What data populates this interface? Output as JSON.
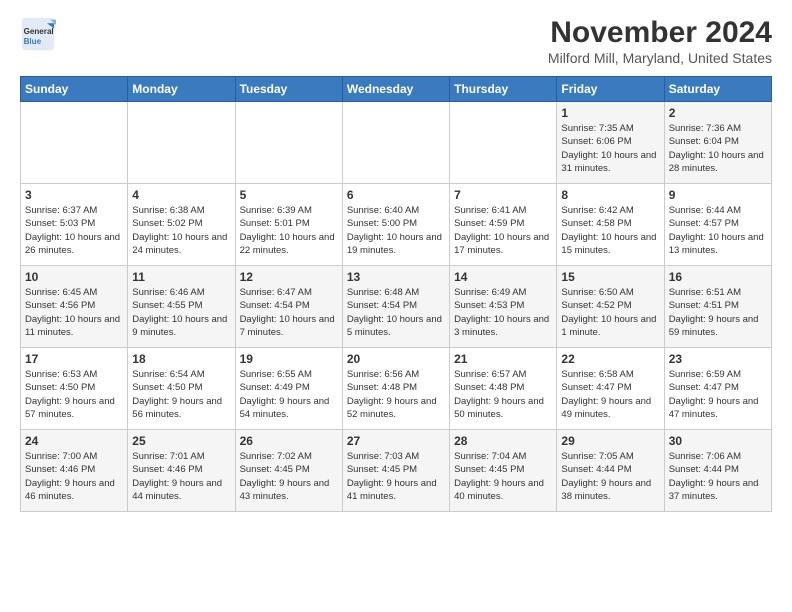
{
  "logo": {
    "general": "General",
    "blue": "Blue"
  },
  "header": {
    "title": "November 2024",
    "location": "Milford Mill, Maryland, United States"
  },
  "weekdays": [
    "Sunday",
    "Monday",
    "Tuesday",
    "Wednesday",
    "Thursday",
    "Friday",
    "Saturday"
  ],
  "weeks": [
    [
      {
        "day": "",
        "content": ""
      },
      {
        "day": "",
        "content": ""
      },
      {
        "day": "",
        "content": ""
      },
      {
        "day": "",
        "content": ""
      },
      {
        "day": "",
        "content": ""
      },
      {
        "day": "1",
        "content": "Sunrise: 7:35 AM\nSunset: 6:06 PM\nDaylight: 10 hours and 31 minutes."
      },
      {
        "day": "2",
        "content": "Sunrise: 7:36 AM\nSunset: 6:04 PM\nDaylight: 10 hours and 28 minutes."
      }
    ],
    [
      {
        "day": "3",
        "content": "Sunrise: 6:37 AM\nSunset: 5:03 PM\nDaylight: 10 hours and 26 minutes."
      },
      {
        "day": "4",
        "content": "Sunrise: 6:38 AM\nSunset: 5:02 PM\nDaylight: 10 hours and 24 minutes."
      },
      {
        "day": "5",
        "content": "Sunrise: 6:39 AM\nSunset: 5:01 PM\nDaylight: 10 hours and 22 minutes."
      },
      {
        "day": "6",
        "content": "Sunrise: 6:40 AM\nSunset: 5:00 PM\nDaylight: 10 hours and 19 minutes."
      },
      {
        "day": "7",
        "content": "Sunrise: 6:41 AM\nSunset: 4:59 PM\nDaylight: 10 hours and 17 minutes."
      },
      {
        "day": "8",
        "content": "Sunrise: 6:42 AM\nSunset: 4:58 PM\nDaylight: 10 hours and 15 minutes."
      },
      {
        "day": "9",
        "content": "Sunrise: 6:44 AM\nSunset: 4:57 PM\nDaylight: 10 hours and 13 minutes."
      }
    ],
    [
      {
        "day": "10",
        "content": "Sunrise: 6:45 AM\nSunset: 4:56 PM\nDaylight: 10 hours and 11 minutes."
      },
      {
        "day": "11",
        "content": "Sunrise: 6:46 AM\nSunset: 4:55 PM\nDaylight: 10 hours and 9 minutes."
      },
      {
        "day": "12",
        "content": "Sunrise: 6:47 AM\nSunset: 4:54 PM\nDaylight: 10 hours and 7 minutes."
      },
      {
        "day": "13",
        "content": "Sunrise: 6:48 AM\nSunset: 4:54 PM\nDaylight: 10 hours and 5 minutes."
      },
      {
        "day": "14",
        "content": "Sunrise: 6:49 AM\nSunset: 4:53 PM\nDaylight: 10 hours and 3 minutes."
      },
      {
        "day": "15",
        "content": "Sunrise: 6:50 AM\nSunset: 4:52 PM\nDaylight: 10 hours and 1 minute."
      },
      {
        "day": "16",
        "content": "Sunrise: 6:51 AM\nSunset: 4:51 PM\nDaylight: 9 hours and 59 minutes."
      }
    ],
    [
      {
        "day": "17",
        "content": "Sunrise: 6:53 AM\nSunset: 4:50 PM\nDaylight: 9 hours and 57 minutes."
      },
      {
        "day": "18",
        "content": "Sunrise: 6:54 AM\nSunset: 4:50 PM\nDaylight: 9 hours and 56 minutes."
      },
      {
        "day": "19",
        "content": "Sunrise: 6:55 AM\nSunset: 4:49 PM\nDaylight: 9 hours and 54 minutes."
      },
      {
        "day": "20",
        "content": "Sunrise: 6:56 AM\nSunset: 4:48 PM\nDaylight: 9 hours and 52 minutes."
      },
      {
        "day": "21",
        "content": "Sunrise: 6:57 AM\nSunset: 4:48 PM\nDaylight: 9 hours and 50 minutes."
      },
      {
        "day": "22",
        "content": "Sunrise: 6:58 AM\nSunset: 4:47 PM\nDaylight: 9 hours and 49 minutes."
      },
      {
        "day": "23",
        "content": "Sunrise: 6:59 AM\nSunset: 4:47 PM\nDaylight: 9 hours and 47 minutes."
      }
    ],
    [
      {
        "day": "24",
        "content": "Sunrise: 7:00 AM\nSunset: 4:46 PM\nDaylight: 9 hours and 46 minutes."
      },
      {
        "day": "25",
        "content": "Sunrise: 7:01 AM\nSunset: 4:46 PM\nDaylight: 9 hours and 44 minutes."
      },
      {
        "day": "26",
        "content": "Sunrise: 7:02 AM\nSunset: 4:45 PM\nDaylight: 9 hours and 43 minutes."
      },
      {
        "day": "27",
        "content": "Sunrise: 7:03 AM\nSunset: 4:45 PM\nDaylight: 9 hours and 41 minutes."
      },
      {
        "day": "28",
        "content": "Sunrise: 7:04 AM\nSunset: 4:45 PM\nDaylight: 9 hours and 40 minutes."
      },
      {
        "day": "29",
        "content": "Sunrise: 7:05 AM\nSunset: 4:44 PM\nDaylight: 9 hours and 38 minutes."
      },
      {
        "day": "30",
        "content": "Sunrise: 7:06 AM\nSunset: 4:44 PM\nDaylight: 9 hours and 37 minutes."
      }
    ]
  ]
}
